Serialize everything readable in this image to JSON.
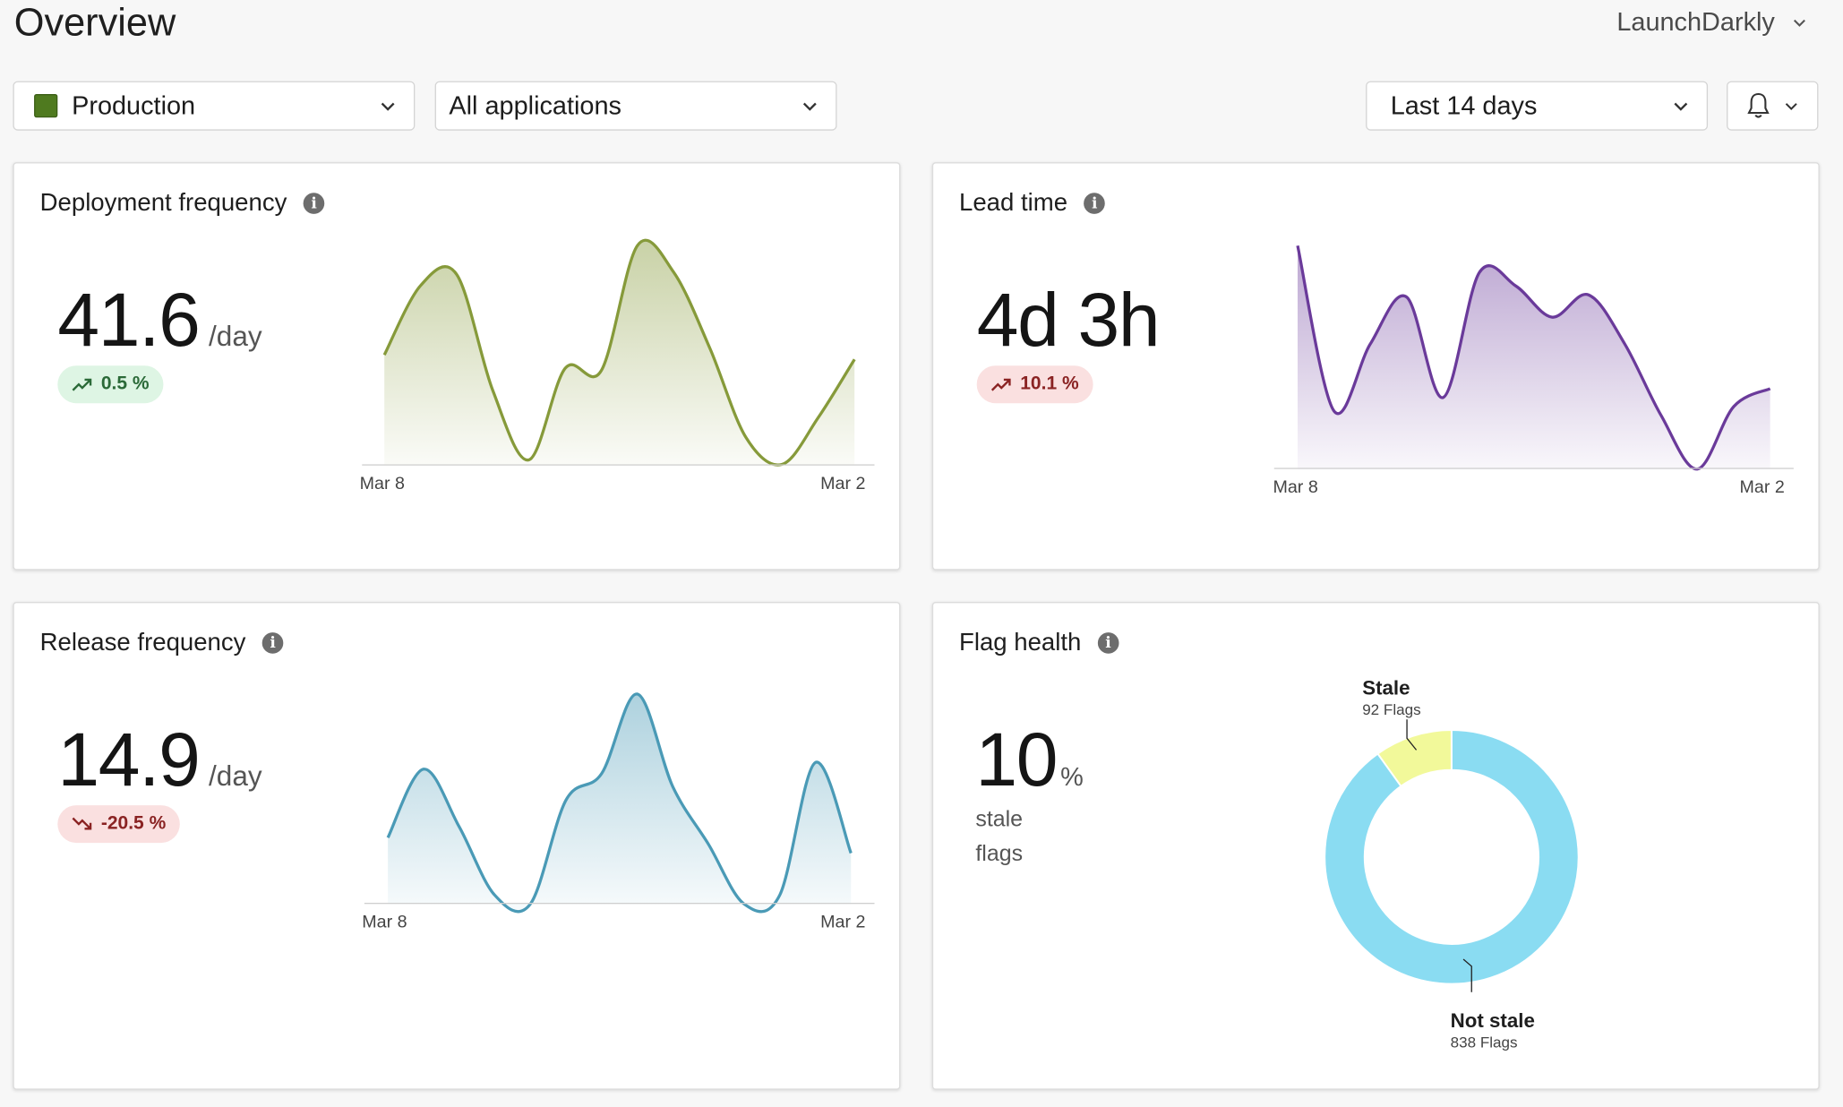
{
  "header": {
    "title": "Overview",
    "org": "LaunchDarkly"
  },
  "filters": {
    "environment": "Production",
    "environment_color": "#4f7a1f",
    "application": "All applications",
    "range": "Last 14 days"
  },
  "cards": {
    "deployment": {
      "title": "Deployment frequency",
      "value": "41.6",
      "unit": "/day",
      "change": "0.5 %",
      "trend": "up",
      "color": "#869a3a",
      "x_start": "Mar 8",
      "x_end": "Mar 2"
    },
    "lead": {
      "title": "Lead time",
      "value": "4d 3h",
      "unit": "",
      "change": "10.1 %",
      "trend": "up",
      "color": "#6a3a9a",
      "x_start": "Mar 8",
      "x_end": "Mar 2"
    },
    "release": {
      "title": "Release frequency",
      "value": "14.9",
      "unit": "/day",
      "change": "-20.5 %",
      "trend": "down",
      "color": "#4a9ab6",
      "x_start": "Mar 8",
      "x_end": "Mar 2"
    },
    "flag": {
      "title": "Flag health",
      "value": "10",
      "unit": "%",
      "sub1": "stale",
      "sub2": "flags",
      "stale_label": "Stale",
      "stale_count": "92 Flags",
      "notstale_label": "Not stale",
      "notstale_count": "838 Flags",
      "stale_color": "#f2f99a",
      "notstale_color": "#8adcf2"
    }
  },
  "chart_data": [
    {
      "type": "area",
      "title": "Deployment frequency",
      "x_labels": [
        "Mar 8",
        "Mar 2"
      ],
      "values": [
        0.49,
        0.8,
        0.85,
        0.33,
        0.02,
        0.43,
        0.42,
        0.98,
        0.86,
        0.52,
        0.12,
        0.0,
        0.21,
        0.47
      ],
      "y_scale": "relative (no axis printed)"
    },
    {
      "type": "area",
      "title": "Lead time",
      "x_labels": [
        "Mar 8",
        "Mar 2"
      ],
      "values": [
        1.0,
        0.26,
        0.56,
        0.77,
        0.32,
        0.88,
        0.82,
        0.68,
        0.78,
        0.56,
        0.24,
        0.0,
        0.28,
        0.36
      ],
      "y_scale": "relative (no axis printed)"
    },
    {
      "type": "area",
      "title": "Release frequency",
      "x_labels": [
        "Mar 8",
        "Mar 2"
      ],
      "values": [
        0.3,
        0.61,
        0.35,
        0.04,
        0.0,
        0.47,
        0.59,
        0.95,
        0.53,
        0.27,
        0.0,
        0.04,
        0.64,
        0.23
      ],
      "y_scale": "relative (no axis printed)"
    },
    {
      "type": "pie",
      "title": "Flag health",
      "labels": [
        "Stale",
        "Not stale"
      ],
      "values": [
        92,
        838
      ]
    }
  ]
}
